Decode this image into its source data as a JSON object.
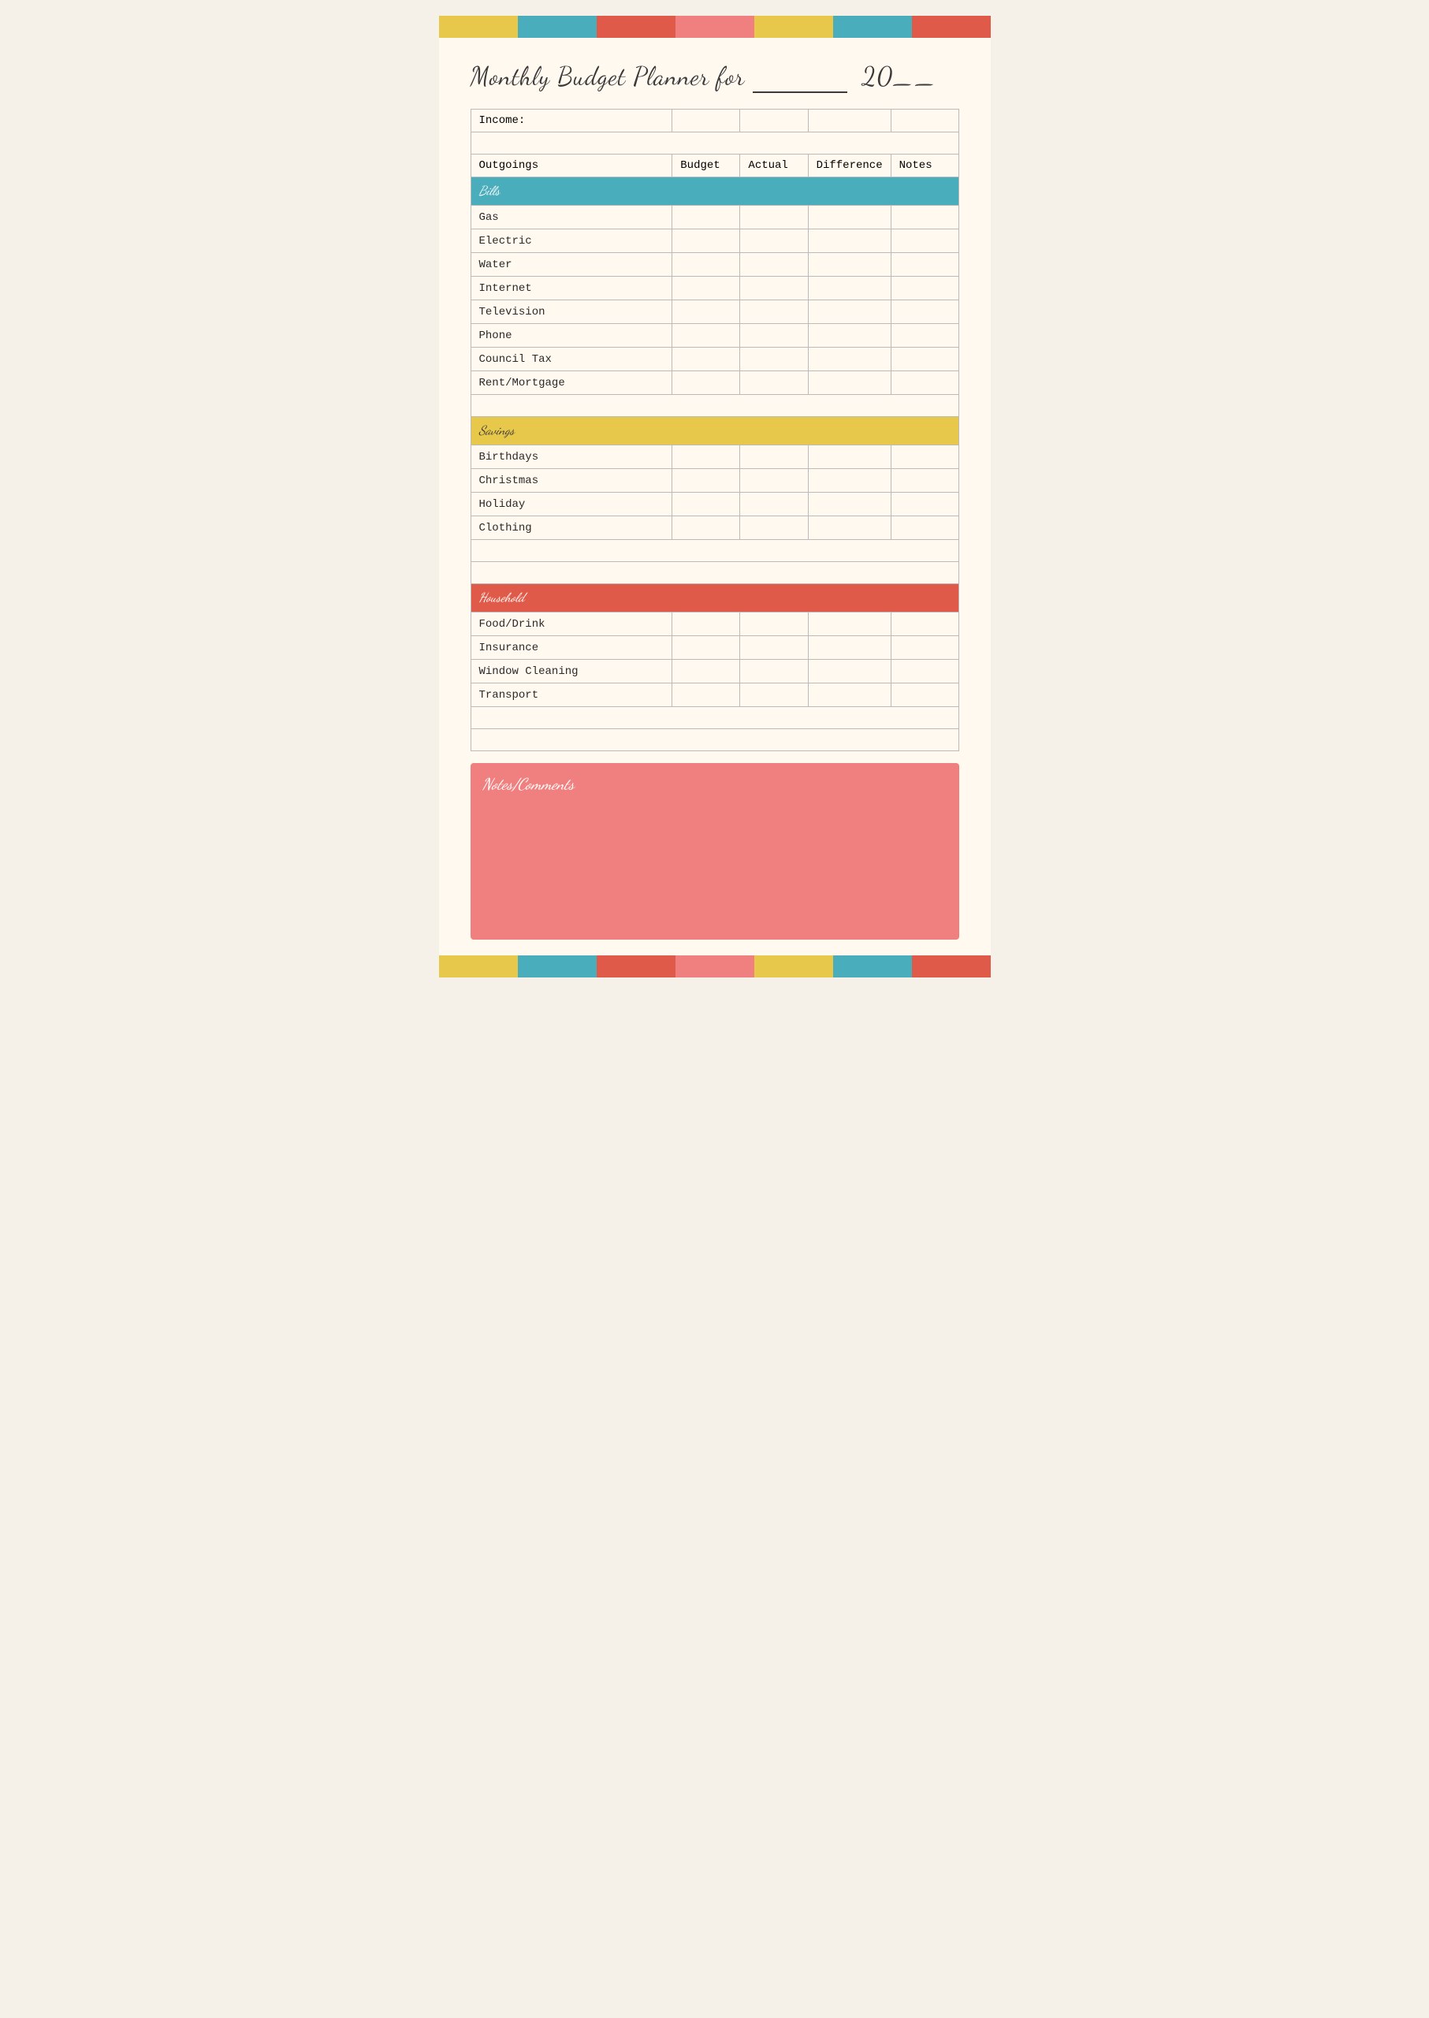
{
  "colorBar": {
    "segments": [
      "#e8c84a",
      "#4aadbc",
      "#e05a4a",
      "#f08080",
      "#e8c84a",
      "#4aadbc",
      "#e05a4a"
    ]
  },
  "title": {
    "prefix": "Monthly Budget Planner for",
    "line": "___________",
    "year": "20__"
  },
  "table": {
    "incomeLabel": "Income:",
    "outgoingsLabel": "Outgoings",
    "budgetLabel": "Budget",
    "actualLabel": "Actual",
    "differenceLabel": "Difference",
    "notesLabel": "Notes",
    "sections": [
      {
        "name": "Bills",
        "rows": [
          "Gas",
          "Electric",
          "Water",
          "Internet",
          "Television",
          "Phone",
          "Council Tax",
          "Rent/Mortgage",
          ""
        ]
      },
      {
        "name": "Savings",
        "rows": [
          "Birthdays",
          "Christmas",
          "Holiday",
          "Clothing",
          "",
          ""
        ]
      },
      {
        "name": "Household",
        "rows": [
          "Food/Drink",
          "Insurance",
          "Window Cleaning",
          "Transport",
          "",
          ""
        ]
      }
    ]
  },
  "notesSection": {
    "title": "Notes/Comments"
  }
}
